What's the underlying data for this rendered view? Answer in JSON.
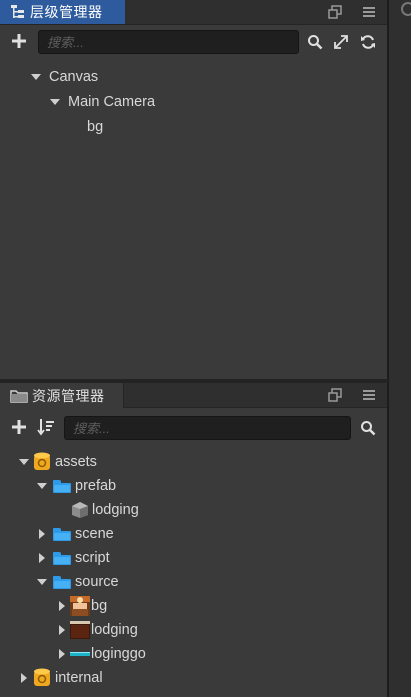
{
  "hierarchy": {
    "title": "层级管理器",
    "search_placeholder": "搜索...",
    "nodes": [
      {
        "label": "Canvas",
        "depth": 0,
        "state": "expanded"
      },
      {
        "label": "Main Camera",
        "depth": 1,
        "state": "expanded"
      },
      {
        "label": "bg",
        "depth": 2,
        "state": "leaf"
      }
    ]
  },
  "assets": {
    "title": "资源管理器",
    "search_placeholder": "搜索...",
    "nodes": [
      {
        "label": "assets",
        "depth": 0,
        "state": "expanded",
        "icon": "database-icon"
      },
      {
        "label": "prefab",
        "depth": 1,
        "state": "expanded",
        "icon": "folder-icon"
      },
      {
        "label": "lodging",
        "depth": 2,
        "state": "leaf",
        "icon": "prefab-cube-icon"
      },
      {
        "label": "scene",
        "depth": 1,
        "state": "collapsed",
        "icon": "folder-icon"
      },
      {
        "label": "script",
        "depth": 1,
        "state": "collapsed",
        "icon": "folder-icon"
      },
      {
        "label": "source",
        "depth": 1,
        "state": "expanded",
        "icon": "folder-icon"
      },
      {
        "label": "bg",
        "depth": 2,
        "state": "collapsed",
        "icon": "bg-thumbnail-icon"
      },
      {
        "label": "lodging",
        "depth": 2,
        "state": "collapsed",
        "icon": "lodging-thumbnail-icon"
      },
      {
        "label": "loginggo",
        "depth": 2,
        "state": "collapsed",
        "icon": "loginggo-thumbnail-icon"
      },
      {
        "label": "internal",
        "depth": 0,
        "state": "collapsed",
        "icon": "database-icon"
      }
    ]
  },
  "colors": {
    "active_tab": "#2d5b9d",
    "panel_bg": "#3a3a3a",
    "folder": "#2e9ae8",
    "database": "#f0a81e"
  }
}
